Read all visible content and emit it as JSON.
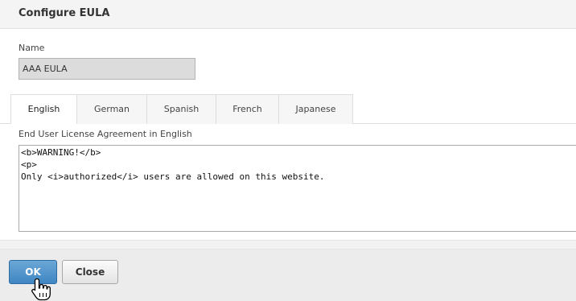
{
  "dialog": {
    "title": "Configure EULA"
  },
  "name_field": {
    "label": "Name",
    "value": "AAA EULA"
  },
  "tabs": [
    {
      "label": "English",
      "active": true
    },
    {
      "label": "German",
      "active": false
    },
    {
      "label": "Spanish",
      "active": false
    },
    {
      "label": "French",
      "active": false
    },
    {
      "label": "Japanese",
      "active": false
    }
  ],
  "eula": {
    "label": "End User License Agreement in English",
    "text": "<b>WARNING!</b>\n<p>\nOnly <i>authorized</i> users are allowed on this website."
  },
  "footer": {
    "ok_label": "OK",
    "close_label": "Close"
  },
  "cursor": {
    "icon": "hand-pointer-icon"
  },
  "colors": {
    "primary_button": "#3f86c3",
    "header_bg": "#f4f4f4",
    "footer_bg": "#ececec"
  }
}
